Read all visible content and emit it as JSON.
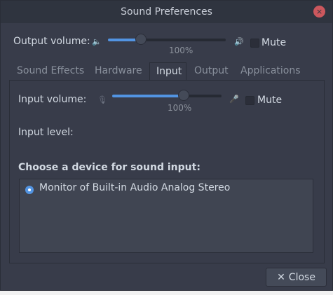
{
  "window": {
    "title": "Sound Preferences",
    "close_glyph": "×"
  },
  "output": {
    "label": "Output volume:",
    "value": 100,
    "percent_text": "100%",
    "mute_label": "Mute",
    "mute_checked": false
  },
  "tabs": [
    {
      "label": "Sound Effects",
      "active": false
    },
    {
      "label": "Hardware",
      "active": false
    },
    {
      "label": "Input",
      "active": true
    },
    {
      "label": "Output",
      "active": false
    },
    {
      "label": "Applications",
      "active": false
    }
  ],
  "input": {
    "volume_label": "Input volume:",
    "value": 100,
    "percent_text": "100%",
    "mute_label": "Mute",
    "mute_checked": false,
    "level_label": "Input level:",
    "device_heading": "Choose a device for sound input:",
    "devices": [
      {
        "label": "Monitor of Built-in Audio Analog Stereo",
        "selected": true
      }
    ]
  },
  "footer": {
    "close_label": "Close",
    "close_glyph": "✕"
  },
  "colors": {
    "accent": "#5294e2",
    "window_bg": "#383c4a",
    "titlebar_bg": "#2f343f"
  }
}
